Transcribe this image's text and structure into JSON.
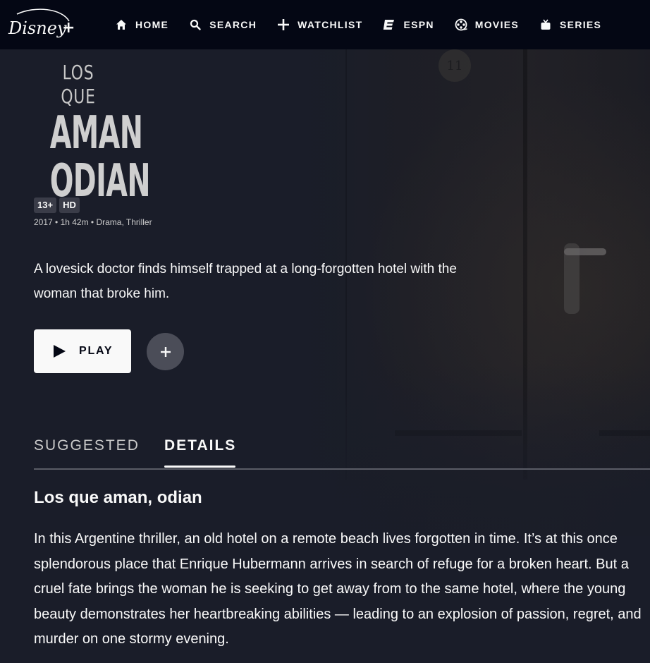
{
  "brand": {
    "logo_text": "Disney+"
  },
  "nav": {
    "items": [
      {
        "label": "HOME",
        "icon": "home-icon"
      },
      {
        "label": "SEARCH",
        "icon": "search-icon"
      },
      {
        "label": "WATCHLIST",
        "icon": "plus-icon"
      },
      {
        "label": "ESPN",
        "icon": "espn-icon"
      },
      {
        "label": "MOVIES",
        "icon": "film-reel-icon"
      },
      {
        "label": "SERIES",
        "icon": "tv-icon"
      }
    ]
  },
  "title_art": {
    "line1": "LOS QUE",
    "line2": "AMAN",
    "line3": "ODIAN"
  },
  "badges": [
    "13+",
    "HD"
  ],
  "meta": "2017 • 1h 42m • Drama, Thriller",
  "description": "A lovesick doctor finds himself trapped at a long-forgotten hotel with the woman that broke him.",
  "actions": {
    "play_label": "PLAY"
  },
  "tabs": [
    {
      "label": "SUGGESTED",
      "active": false
    },
    {
      "label": "DETAILS",
      "active": true
    }
  ],
  "details": {
    "title": "Los que aman, odian",
    "body": "In this Argentine thriller, an old hotel on a remote beach lives forgotten in time. It’s at this once splendorous place that Enrique Hubermann arrives in search of refuge for a broken heart. But a cruel fate brings the woman he is seeking to get away from to the same hotel, where the young beauty demonstrates her heartbreaking abilities — leading to an explosion of passion, regret, and murder on one stormy evening."
  },
  "background": {
    "room_number": "11"
  },
  "colors": {
    "background": "#1a1d29",
    "header": "#040714",
    "text": "#f9f9f9",
    "button": "#f9f9f9"
  }
}
